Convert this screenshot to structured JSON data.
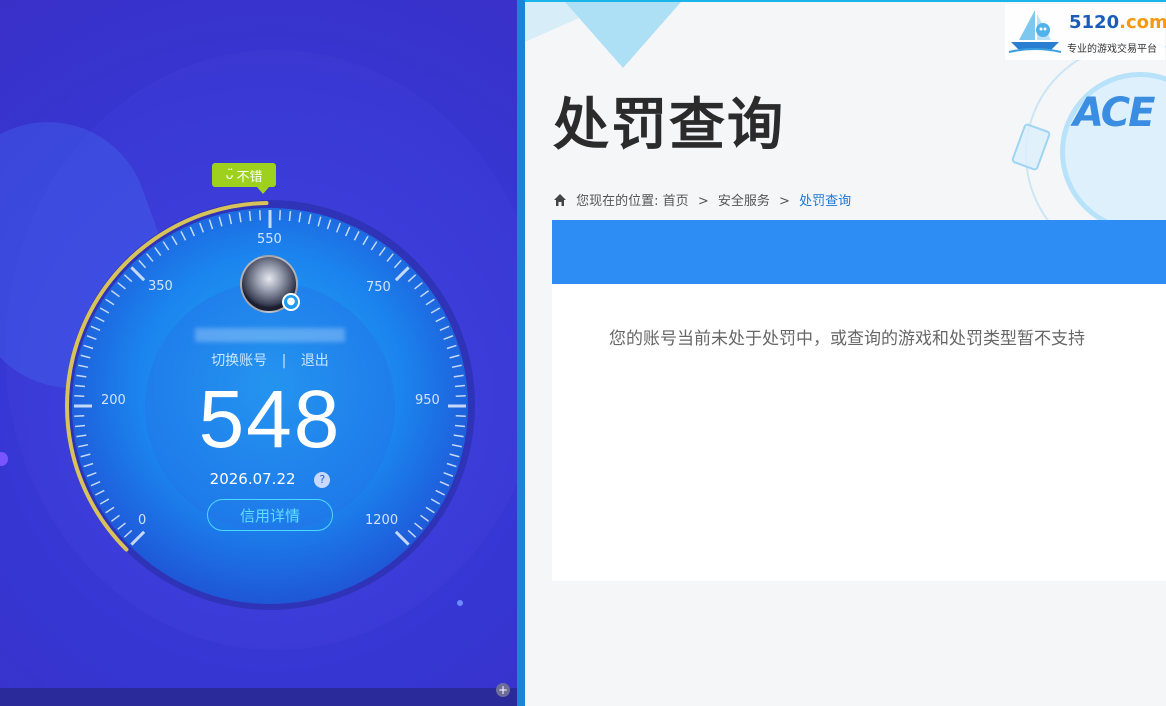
{
  "left_panel": {
    "rating_badge": "不错",
    "gauge_ticks": [
      "0",
      "200",
      "350",
      "550",
      "750",
      "950",
      "1200"
    ],
    "switch_account": "切换账号",
    "separator": "|",
    "logout": "退出",
    "score": "548",
    "date": "2026.07.22",
    "help": "?",
    "detail_button": "信用详情"
  },
  "right_panel": {
    "site": {
      "name": "5120",
      "tld": ".com",
      "slogan": "专业的游戏交易平台"
    },
    "deco_logo": "ACE",
    "title": "处罚查询",
    "breadcrumb": {
      "prefix": "您现在的位置:",
      "home": "首页",
      "sep": ">",
      "section": "安全服务",
      "current": "处罚查询"
    },
    "message": "您的账号当前未处于处罚中，或查询的游戏和处罚类型暂不支持"
  },
  "colors": {
    "left_bg": "#3636d2",
    "badge_green": "#9ed11e",
    "link_cyan": "#5fe0ff",
    "card_header_blue": "#2d8df5",
    "breadcrumb_active": "#1a78d6",
    "site_blue": "#1b5db6",
    "site_orange": "#f39a12"
  }
}
